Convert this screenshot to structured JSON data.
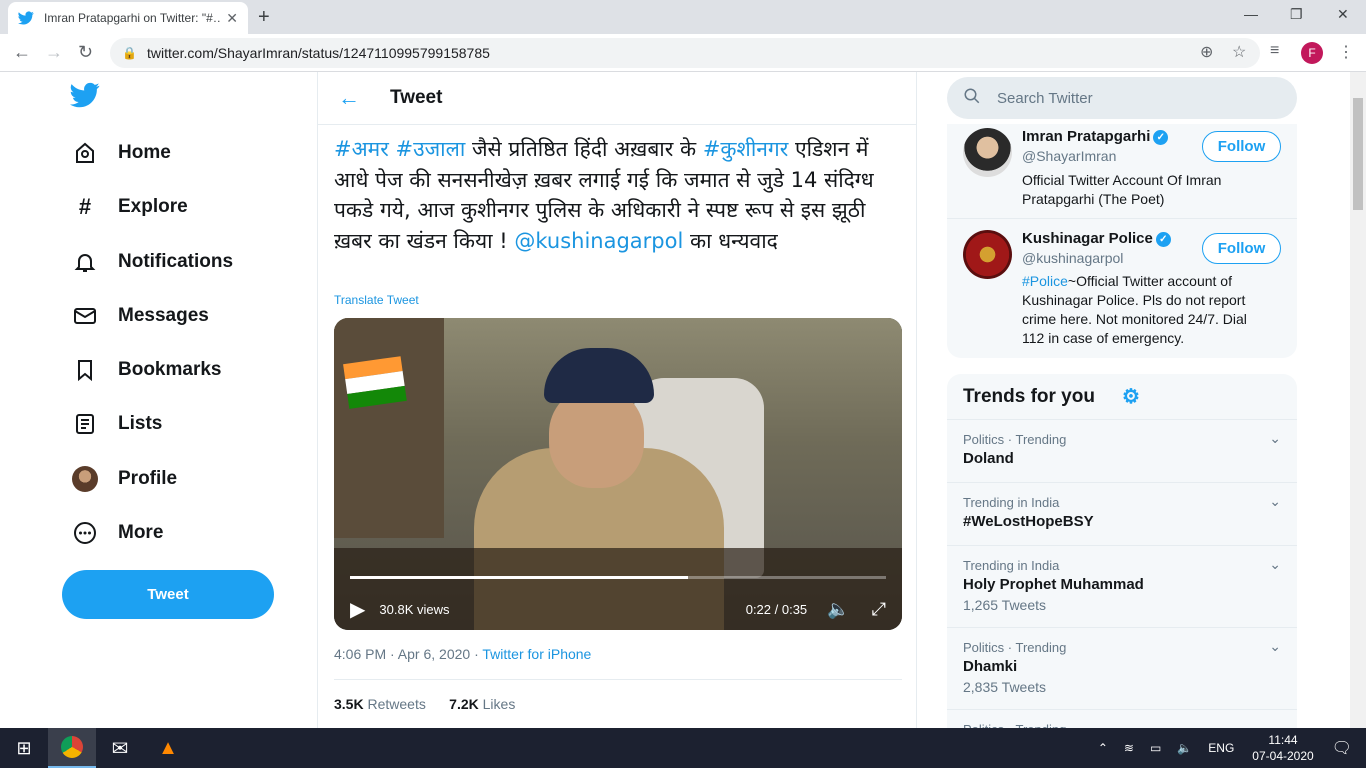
{
  "browser": {
    "tab_title": "Imran Pratapgarhi on Twitter: \"#…",
    "url": "twitter.com/ShayarImran/status/1247110995799158785",
    "profile_letter": "F"
  },
  "nav": {
    "items": [
      {
        "label": "Home",
        "icon": "home-icon"
      },
      {
        "label": "Explore",
        "icon": "hashtag-icon"
      },
      {
        "label": "Notifications",
        "icon": "bell-icon"
      },
      {
        "label": "Messages",
        "icon": "envelope-icon"
      },
      {
        "label": "Bookmarks",
        "icon": "bookmark-icon"
      },
      {
        "label": "Lists",
        "icon": "list-icon"
      },
      {
        "label": "Profile",
        "icon": "avatar-icon"
      },
      {
        "label": "More",
        "icon": "more-icon"
      }
    ],
    "tweet_button": "Tweet"
  },
  "main": {
    "title": "Tweet",
    "tweet": {
      "tag1": "#अमर",
      "tag2": "#उजाला",
      "text1": " जैसे प्रतिष्ठित हिंदी अख़बार के ",
      "tag3": "#कुशीनगर",
      "text2": " एडिशन में आधे पेज की सनसनीखेज़ ख़बर लगाई गई कि जमात से जुडे 14 संदिग्ध पकडे गये, आज कुशीनगर पुलिस के अधिकारी ने स्पष्ट रूप से इस झूठी ख़बर का खंडन किया ! ",
      "mention": "@kushinagarpol",
      "text3": " का धन्यवाद",
      "translate": "Translate Tweet"
    },
    "video": {
      "views": "30.8K views",
      "time": "0:22 / 0:35",
      "progress": 0.63
    },
    "meta": {
      "timestamp": "4:06 PM · Apr 6, 2020",
      "separator": " · ",
      "source": "Twitter for iPhone"
    },
    "stats": {
      "retweets_count": "3.5K",
      "retweets_label": "Retweets",
      "likes_count": "7.2K",
      "likes_label": "Likes"
    }
  },
  "right": {
    "search_placeholder": "Search Twitter",
    "accounts": [
      {
        "name": "Imran Pratapgarhi",
        "handle": "@ShayarImran",
        "bio": "Official Twitter Account Of Imran Pratapgarhi (The Poet)",
        "follow": "Follow"
      },
      {
        "name": "Kushinagar Police",
        "handle": "@kushinagarpol",
        "bio_link": "#Police",
        "bio": "~Official Twitter account of Kushinagar Police. Pls do not report crime here. Not monitored 24/7. Dial 112 in case of emergency.",
        "follow": "Follow"
      }
    ],
    "trends_title": "Trends for you",
    "trends": [
      {
        "context": "Politics · Trending",
        "name": "Doland",
        "count": ""
      },
      {
        "context": "Trending in India",
        "name": "#WeLostHopeBSY",
        "count": ""
      },
      {
        "context": "Trending in India",
        "name": "Holy Prophet Muhammad",
        "count": "1,265 Tweets"
      },
      {
        "context": "Politics · Trending",
        "name": "Dhamki",
        "count": "2,835 Tweets"
      },
      {
        "context": "Politics · Trending",
        "name": "",
        "count": ""
      }
    ]
  },
  "taskbar": {
    "language": "ENG",
    "time": "11:44",
    "date": "07-04-2020"
  },
  "colors": {
    "accent": "#1da1f2",
    "link": "#1b95e0"
  }
}
